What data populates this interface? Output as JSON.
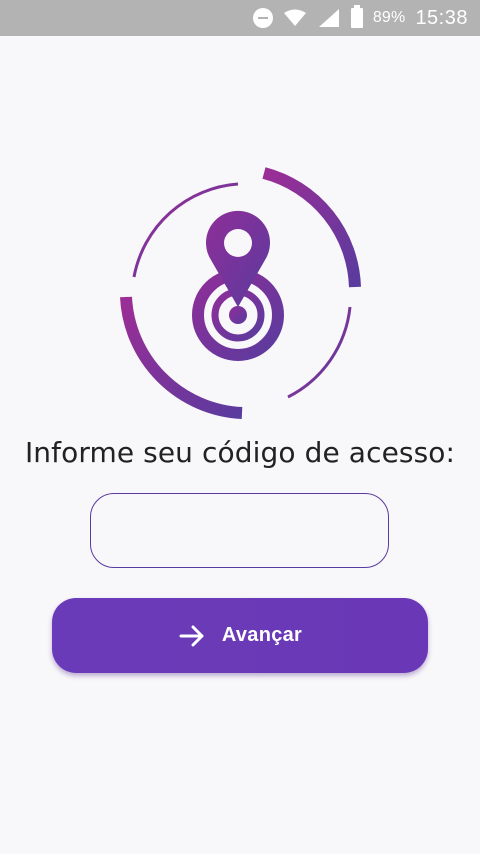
{
  "status_bar": {
    "battery": "89%",
    "time": "15:38",
    "icons": [
      "do-not-disturb-icon",
      "wifi-icon",
      "signal-icon",
      "battery-icon"
    ]
  },
  "logo": {
    "icon": "location-pin-target-icon"
  },
  "form": {
    "prompt": "Informe seu código de acesso:",
    "code_value": "",
    "button_label": "Avançar",
    "button_icon": "arrow-right-icon"
  },
  "colors": {
    "primary": "#6a3bb8",
    "logo_magenta": "#9b2e96",
    "logo_indigo": "#5a3b9e",
    "background": "#f8f7fa",
    "status_bar": "#b3b3b3"
  }
}
